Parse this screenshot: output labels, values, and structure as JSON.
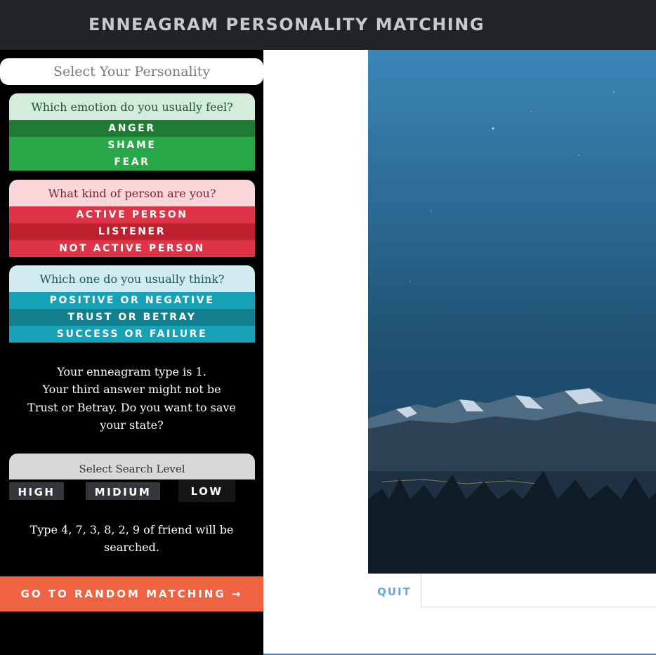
{
  "header": {
    "title": "ENNEAGRAM PERSONALITY MATCHING"
  },
  "sidebar": {
    "select_label": "Select Your Personality",
    "emotion": {
      "question": "Which emotion do you usually feel?",
      "options": [
        "ANGER",
        "SHAME",
        "FEAR"
      ]
    },
    "person": {
      "question": "What kind of person are you?",
      "options": [
        "ACTIVE PERSON",
        "LISTENER",
        "NOT ACTIVE PERSON"
      ]
    },
    "think": {
      "question": "Which one do you usually think?",
      "options": [
        "POSITIVE OR NEGATIVE",
        "TRUST OR BETRAY",
        "SUCCESS OR FAILURE"
      ]
    },
    "result_lines": [
      "Your enneagram type is 1.",
      "Your third answer might not be",
      "Trust or Betray. Do you want to save",
      "your state?"
    ],
    "search": {
      "label": "Select Search Level",
      "levels": [
        "HIGH",
        "MIDIUM",
        "LOW"
      ],
      "note_lines": [
        "Type 4, 7, 3, 8, 2, 9 of friend will be",
        "searched."
      ]
    },
    "random_button": "GO TO RANDOM MATCHING →"
  },
  "main": {
    "quit_label": "QUIT"
  },
  "colors": {
    "topbar": "#212427",
    "accent_orange": "#ef6342",
    "green": "#27a745",
    "red": "#dd3547",
    "teal": "#17a2b8",
    "link_blue": "#64a7e6"
  }
}
